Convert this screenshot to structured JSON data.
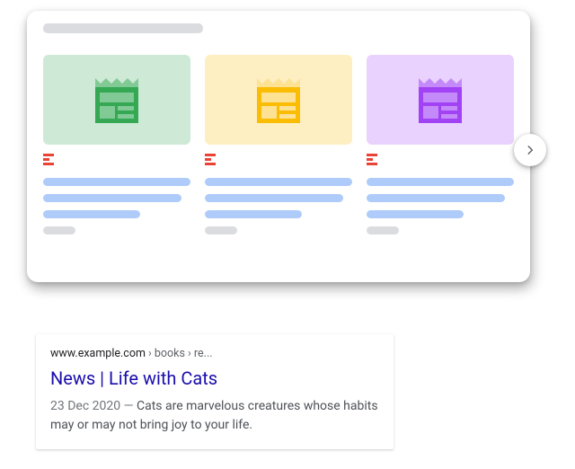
{
  "carousel": {
    "items": [
      {
        "fill": "green",
        "dark": "#34a853",
        "light": "#81c995"
      },
      {
        "fill": "yellow",
        "dark": "#fbbc04",
        "light": "#fde293"
      },
      {
        "fill": "purple",
        "dark": "#a142f4",
        "light": "#c58af9"
      }
    ]
  },
  "result": {
    "breadcrumb_domain": "www.example.com",
    "breadcrumb_path": " › books › re...",
    "title": "News | Life with Cats",
    "date": "23 Dec 2020",
    "sep": " — ",
    "snippet": "Cats are marvelous creatures whose habits may or may not bring joy to your life."
  }
}
